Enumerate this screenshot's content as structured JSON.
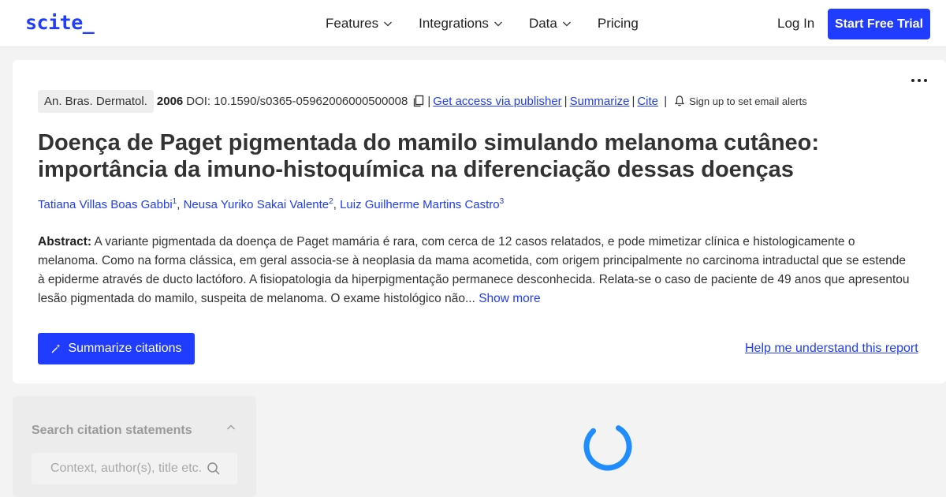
{
  "nav": {
    "logo": "scite_",
    "links": [
      {
        "label": "Features",
        "has_dropdown": true
      },
      {
        "label": "Integrations",
        "has_dropdown": true
      },
      {
        "label": "Data",
        "has_dropdown": true
      },
      {
        "label": "Pricing",
        "has_dropdown": false
      }
    ],
    "login": "Log In",
    "trial": "Start Free Trial"
  },
  "article": {
    "journal": "An. Bras. Dermatol.",
    "year": "2006",
    "doi": "DOI: 10.1590/s0365-05962006000500008",
    "links": {
      "access": "Get access via publisher",
      "summarize": "Summarize",
      "cite": "Cite"
    },
    "alerts": "Sign up to set email alerts",
    "title": "Doença de Paget pigmentada do mamilo simulando melanoma cutâneo: importância da imuno-histoquímica na diferenciação dessas doenças",
    "authors": [
      {
        "name": "Tatiana Villas Boas Gabbi",
        "sup": "1"
      },
      {
        "name": "Neusa Yuriko Sakai Valente",
        "sup": "2"
      },
      {
        "name": "Luiz Guilherme Martins Castro",
        "sup": "3"
      }
    ],
    "abstract_label": "Abstract:",
    "abstract_text": "A variante pigmentada da doença de Paget mamária é rara, com cerca de 12 casos relatados, e pode mimetizar clínica e histologicamente o melanoma. Como na forma clássica, em geral associa-se à neoplasia da mama acometida, com origem principalmente no carcinoma intraductal que se estende à epiderme através de ducto lactóforo. A fisiopatologia da hiperpigmentação permanece desconhecida. Relata-se o caso de paciente de 49 anos que apresentou lesão pigmentada do mamilo, suspeita de melanoma. O exame histológico não...",
    "show_more": "Show more",
    "summarize_citations": "Summarize citations",
    "help": "Help me understand this report"
  },
  "sidebar": {
    "title": "Search citation statements",
    "search_placeholder": "Context, author(s), title etc."
  },
  "colors": {
    "accent": "#1f3cff",
    "page_bg": "#f3f3f3",
    "card_bg": "#ffffff",
    "sidebar_bg": "#ececec"
  }
}
